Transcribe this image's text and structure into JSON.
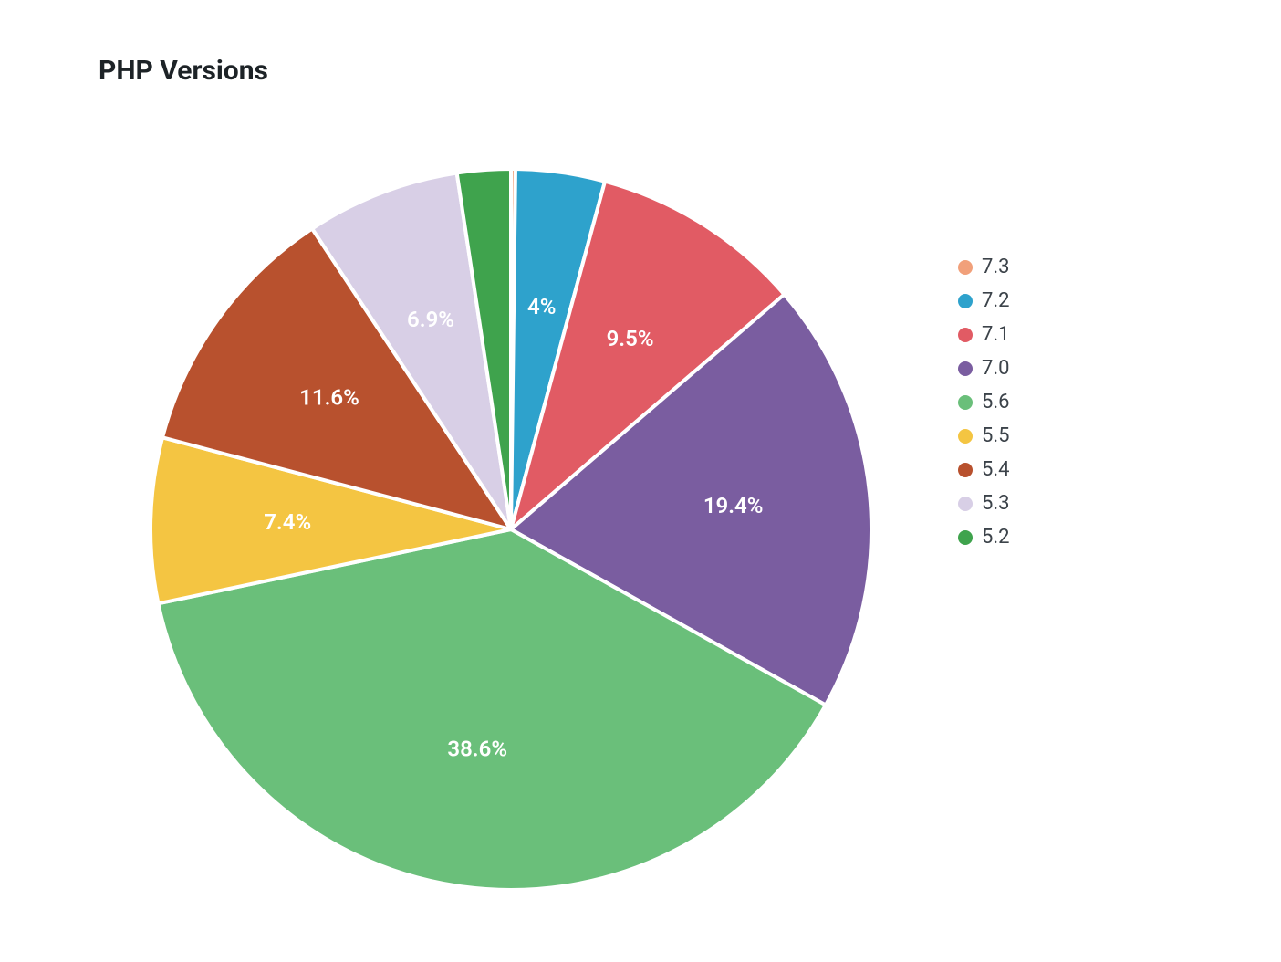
{
  "chart_data": {
    "type": "pie",
    "title": "PHP Versions",
    "series": [
      {
        "name": "7.3",
        "value": 0.2,
        "label": "",
        "color": "#f1a07a"
      },
      {
        "name": "7.2",
        "value": 4.0,
        "label": "4%",
        "color": "#2ea2cc"
      },
      {
        "name": "7.1",
        "value": 9.5,
        "label": "9.5%",
        "color": "#e15b64"
      },
      {
        "name": "7.0",
        "value": 19.4,
        "label": "19.4%",
        "color": "#7a5da0"
      },
      {
        "name": "5.6",
        "value": 38.6,
        "label": "38.6%",
        "color": "#6abf7a"
      },
      {
        "name": "5.5",
        "value": 7.4,
        "label": "7.4%",
        "color": "#f4c542"
      },
      {
        "name": "5.4",
        "value": 11.6,
        "label": "11.6%",
        "color": "#b8512e"
      },
      {
        "name": "5.3",
        "value": 6.9,
        "label": "6.9%",
        "color": "#d8cfe6"
      },
      {
        "name": "5.2",
        "value": 2.4,
        "label": "",
        "color": "#3fa34d"
      }
    ],
    "legend_position": "right"
  }
}
